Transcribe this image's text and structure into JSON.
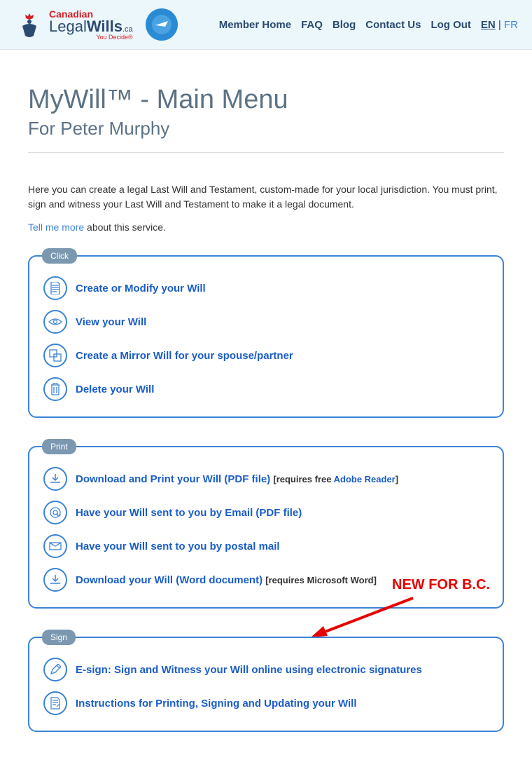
{
  "header": {
    "logo_top": "Canadian",
    "logo_main_a": "Legal",
    "logo_main_b": "Wills",
    "logo_tag": "You Decide®",
    "nav": {
      "home": "Member Home",
      "faq": "FAQ",
      "blog": "Blog",
      "contact": "Contact Us",
      "logout": "Log Out",
      "lang_active": "EN",
      "lang_sep": " | ",
      "lang_other": "FR"
    }
  },
  "page": {
    "title": "MyWill™ - Main Menu",
    "subtitle": "For Peter Murphy",
    "intro": "Here you can create a legal Last Will and Testament, custom-made for your local jurisdiction. You must print, sign and witness your Last Will and Testament to make it a legal document.",
    "more_link": "Tell me more",
    "more_suffix": " about this service."
  },
  "sections": {
    "click": {
      "label": "Click",
      "items": [
        {
          "link": "Create or Modify your Will"
        },
        {
          "link": "View your Will"
        },
        {
          "link": "Create a Mirror Will for your spouse/partner"
        },
        {
          "link": "Delete your Will"
        }
      ]
    },
    "print": {
      "label": "Print",
      "items": [
        {
          "link": "Download and Print your Will (PDF file)",
          "note_pre": " [requires free ",
          "note_link": "Adobe Reader",
          "note_post": "]"
        },
        {
          "link": "Have your Will sent to you by Email (PDF file)"
        },
        {
          "link": "Have your Will sent to you by postal mail"
        },
        {
          "link": "Download your Will (Word document)",
          "note": " [requires Microsoft Word]"
        }
      ]
    },
    "sign": {
      "label": "Sign",
      "items": [
        {
          "link": "E-sign: Sign and Witness your Will online using electronic signatures"
        },
        {
          "link": "Instructions for Printing, Signing and Updating your Will"
        }
      ]
    }
  },
  "callout": "NEW FOR B.C."
}
